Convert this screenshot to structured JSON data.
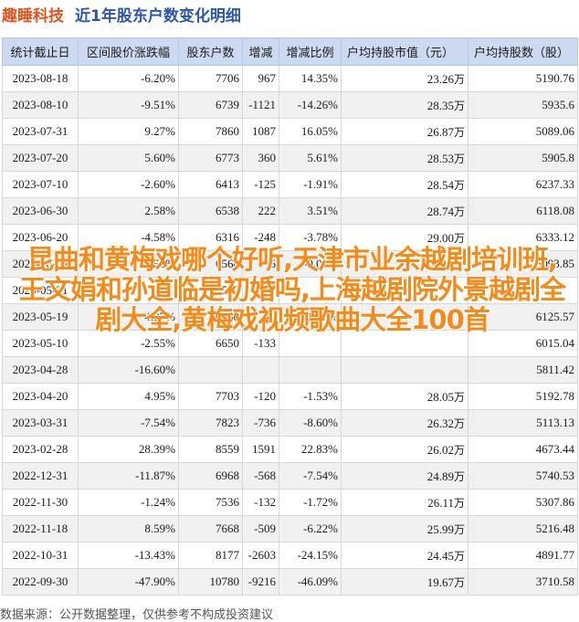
{
  "header": {
    "brand": "趣睡科技",
    "title": "近1年股东户数变化明细"
  },
  "columns": [
    "统计截止日",
    "区间股价涨跌幅",
    "股东户数",
    "增减",
    "增减比例",
    "户均持股市值（元）",
    "户均持股数（股）"
  ],
  "unit_wan": "万",
  "rows": [
    {
      "date": "2023-08-18",
      "change": "-6.20%",
      "holders": "7706",
      "delta": "967",
      "ratio": "14.35%",
      "value": "23.26",
      "shares": "5190.76"
    },
    {
      "date": "2023-08-10",
      "change": "-9.51%",
      "holders": "6739",
      "delta": "-1121",
      "ratio": "-14.26%",
      "value": "28.35",
      "shares": "5935.6"
    },
    {
      "date": "2023-07-31",
      "change": "9.27%",
      "holders": "7860",
      "delta": "1087",
      "ratio": "16.05%",
      "value": "26.87",
      "shares": "5089.06"
    },
    {
      "date": "2023-07-20",
      "change": "5.60%",
      "holders": "6773",
      "delta": "360",
      "ratio": "5.61%",
      "value": "28.53",
      "shares": "5905.8"
    },
    {
      "date": "2023-07-10",
      "change": "-2.60%",
      "holders": "6413",
      "delta": "-125",
      "ratio": "-1.91%",
      "value": "28.54",
      "shares": "6237.33"
    },
    {
      "date": "2023-06-30",
      "change": "2.58%",
      "holders": "6538",
      "delta": "222",
      "ratio": "3.51%",
      "value": "28.74",
      "shares": "6118.08"
    },
    {
      "date": "2023-06-20",
      "change": "-4.58%",
      "holders": "6316",
      "delta": "-248",
      "ratio": "-3.78%",
      "value": "29.00",
      "shares": "6333.12"
    },
    {
      "date": "2023-06-09",
      "change": "-3.53%",
      "holders": "6564",
      "delta": "-6",
      "ratio": "-0.09%",
      "value": "",
      "shares": "6093.85"
    },
    {
      "date": "2023-05-31",
      "change": "",
      "holders": "6570",
      "delta": "",
      "ratio": "",
      "value": "",
      "shares": ""
    },
    {
      "date": "2023-05-19",
      "change": "4.97%",
      "holders": "6530",
      "delta": "-40",
      "ratio": "-1.80%",
      "value": "",
      "shares": "6125.57"
    },
    {
      "date": "2023-05-10",
      "change": "-2.55%",
      "holders": "6650",
      "delta": "-133",
      "ratio": "",
      "value": "",
      "shares": "6015.04"
    },
    {
      "date": "2023-04-28",
      "change": "-16.60%",
      "holders": "",
      "delta": "",
      "ratio": "",
      "value": "",
      "shares": "5811.42"
    },
    {
      "date": "2023-04-20",
      "change": "4.95%",
      "holders": "7703",
      "delta": "-120",
      "ratio": "-1.53%",
      "value": "28.05",
      "shares": "5192.78"
    },
    {
      "date": "2023-03-31",
      "change": "-7.54%",
      "holders": "7823",
      "delta": "-736",
      "ratio": "-8.60%",
      "value": "26.32",
      "shares": "5113.13"
    },
    {
      "date": "2023-02-28",
      "change": "28.39%",
      "holders": "8559",
      "delta": "1591",
      "ratio": "22.83%",
      "value": "26.02",
      "shares": "4673.44"
    },
    {
      "date": "2022-12-31",
      "change": "-11.87%",
      "holders": "6968",
      "delta": "-568",
      "ratio": "-7.54%",
      "value": "24.89",
      "shares": "5740.53"
    },
    {
      "date": "2022-11-30",
      "change": "-1.24%",
      "holders": "7536",
      "delta": "-132",
      "ratio": "-1.72%",
      "value": "26.11",
      "shares": "5307.86"
    },
    {
      "date": "2022-11-18",
      "change": "8.59%",
      "holders": "7668",
      "delta": "-509",
      "ratio": "-6.22%",
      "value": "25.99",
      "shares": "5216.48"
    },
    {
      "date": "2022-10-31",
      "change": "-13.43%",
      "holders": "8177",
      "delta": "-2603",
      "ratio": "-24.15%",
      "value": "24.45",
      "shares": "4891.77"
    },
    {
      "date": "2022-09-30",
      "change": "-47.90%",
      "holders": "10780",
      "delta": "-9216",
      "ratio": "-46.09%",
      "value": "19.67",
      "shares": "3710.58"
    }
  ],
  "overlay_text": "昆曲和黄梅戏哪个好听,天津市业余越剧培训班,王文娟和孙道临是初婚吗,上海越剧院外景越剧全剧大全,黄梅戏视频歌曲大全100首",
  "footer": "数据来源：公开数据整理，仅供参考不构成投资建议",
  "colors": {
    "brand": "#e8521e",
    "title": "#2b56b0",
    "up": "#e0171b",
    "down": "#1e9a39",
    "header_bg": "#ccd9f0",
    "overlay": "#f68a19"
  }
}
